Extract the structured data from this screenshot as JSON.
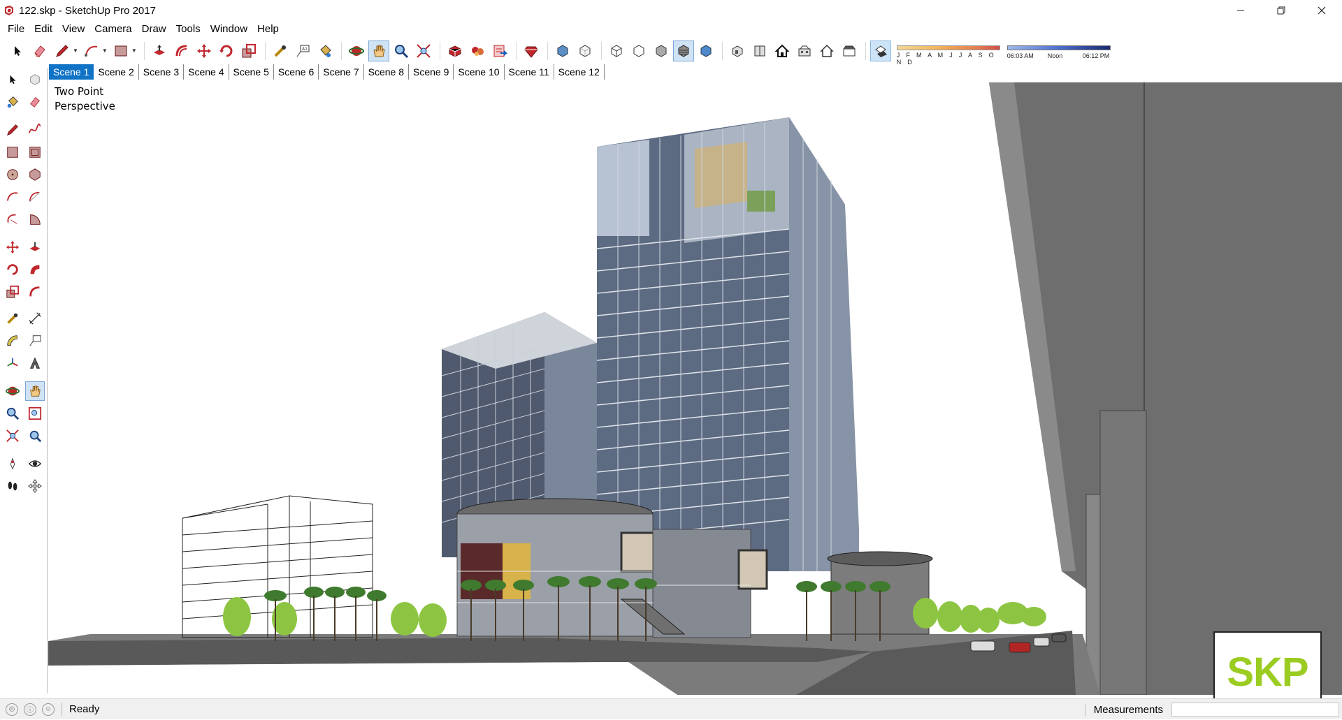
{
  "window": {
    "title": "122.skp - SketchUp Pro 2017",
    "minimize_icon": "minimize-icon",
    "maximize_icon": "restore-icon",
    "close_icon": "close-icon"
  },
  "menu": {
    "items": [
      "File",
      "Edit",
      "View",
      "Camera",
      "Draw",
      "Tools",
      "Window",
      "Help"
    ]
  },
  "shadow": {
    "months": "J F M A M J J A S O N D",
    "time_start": "06:03 AM",
    "time_mid": "Noon",
    "time_end": "06:12 PM"
  },
  "scenes": {
    "tabs": [
      "Scene 1",
      "Scene 2",
      "Scene 3",
      "Scene 4",
      "Scene 5",
      "Scene 6",
      "Scene 7",
      "Scene 8",
      "Scene 9",
      "Scene 10",
      "Scene 11",
      "Scene 12"
    ],
    "active": "Scene 1"
  },
  "viewport": {
    "camera_label_line1": "Two Point",
    "camera_label_line2": "Perspective",
    "logo_text": "SKP"
  },
  "status": {
    "text": "Ready",
    "measurements_label": "Measurements",
    "measurements_value": ""
  },
  "colors": {
    "accent": "#1173c6",
    "logo_green": "#9bcc21",
    "sketchup_red": "#c0282d"
  }
}
